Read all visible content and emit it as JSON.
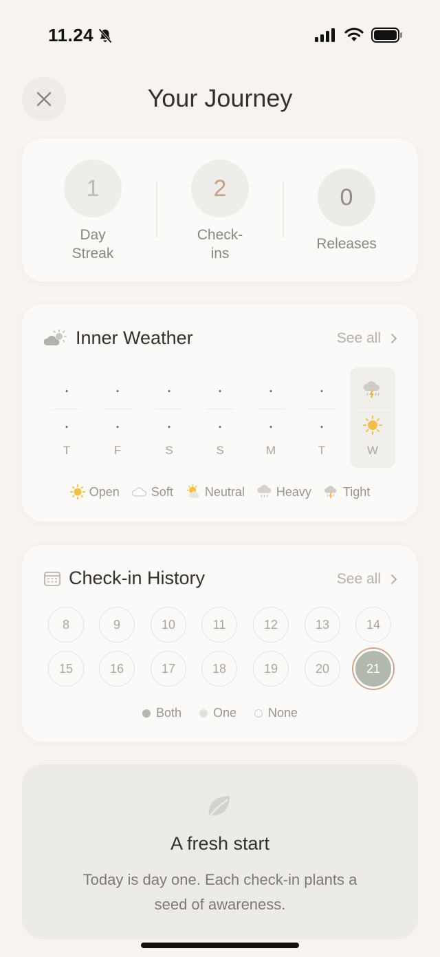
{
  "status_bar": {
    "time": "11.24"
  },
  "header": {
    "title": "Your Journey"
  },
  "stats": [
    {
      "value": "1",
      "label_line1": "Day",
      "label_line2": "Streak",
      "color": "#b7bdb2",
      "bg": "#efedea"
    },
    {
      "value": "2",
      "label_line1": "Check-",
      "label_line2": "ins",
      "color": "#c5a085",
      "bg": "#efedea"
    },
    {
      "value": "0",
      "label_line1": "Releases",
      "label_line2": "",
      "color": "#8f8a84",
      "bg": "#ecebe8"
    }
  ],
  "weather": {
    "title": "Inner Weather",
    "see_all": "See all",
    "days": [
      {
        "letter": "T"
      },
      {
        "letter": "F"
      },
      {
        "letter": "S"
      },
      {
        "letter": "S"
      },
      {
        "letter": "M"
      },
      {
        "letter": "T"
      },
      {
        "letter": "W"
      }
    ],
    "legend": [
      {
        "label": "Open",
        "icon": "sun-icon"
      },
      {
        "label": "Soft",
        "icon": "cloud-icon"
      },
      {
        "label": "Neutral",
        "icon": "sun-cloud-icon"
      },
      {
        "label": "Heavy",
        "icon": "rain-icon"
      },
      {
        "label": "Tight",
        "icon": "storm-icon"
      }
    ]
  },
  "history": {
    "title": "Check-in History",
    "see_all": "See all",
    "dates_row1": [
      "8",
      "9",
      "10",
      "11",
      "12",
      "13",
      "14"
    ],
    "dates_row2": [
      "15",
      "16",
      "17",
      "18",
      "19",
      "20",
      "21"
    ],
    "legend": [
      {
        "label": "Both",
        "color": "#b4b8ae"
      },
      {
        "label": "One",
        "color": "#e2e1de"
      },
      {
        "label": "None",
        "color": "#ffffff"
      }
    ]
  },
  "fresh_start": {
    "title": "A fresh start",
    "line1": "Today is day one. Each check-in plants a",
    "line2": "seed of awareness."
  }
}
